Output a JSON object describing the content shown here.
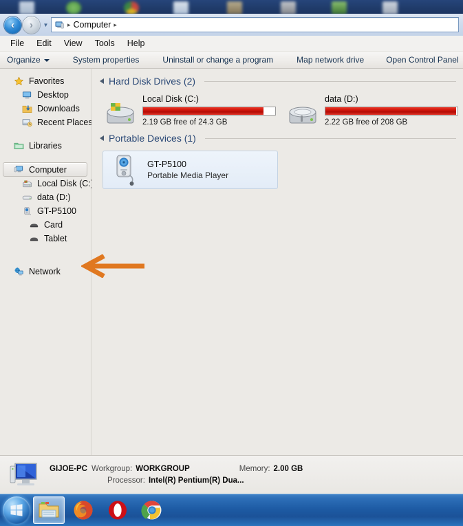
{
  "window": {
    "address": {
      "back_icon": "back-arrow-icon",
      "forward_icon": "forward-arrow-icon",
      "dropdown_icon": "chevron-down-icon",
      "computer_icon": "computer-icon",
      "breadcrumb": "Computer",
      "separator": "▸"
    },
    "menu": {
      "items": [
        {
          "label": "File"
        },
        {
          "label": "Edit"
        },
        {
          "label": "View"
        },
        {
          "label": "Tools"
        },
        {
          "label": "Help"
        }
      ]
    },
    "toolbar": {
      "organize_label": "Organize",
      "organize_caret_icon": "caret-down-icon",
      "items": [
        {
          "label": "System properties"
        },
        {
          "label": "Uninstall or change a program"
        },
        {
          "label": "Map network drive"
        },
        {
          "label": "Open Control Panel"
        }
      ]
    }
  },
  "sidebar": {
    "groups": [
      {
        "items": [
          {
            "label": "Favorites",
            "icon": "star-icon",
            "level": 0,
            "selected": false
          },
          {
            "label": "Desktop",
            "icon": "desktop-icon",
            "level": 1,
            "selected": false
          },
          {
            "label": "Downloads",
            "icon": "downloads-icon",
            "level": 1,
            "selected": false
          },
          {
            "label": "Recent Places",
            "icon": "recent-places-icon",
            "level": 1,
            "selected": false
          }
        ]
      },
      {
        "items": [
          {
            "label": "Libraries",
            "icon": "libraries-folder-icon",
            "level": 0,
            "selected": false
          }
        ]
      },
      {
        "items": [
          {
            "label": "Computer",
            "icon": "computer-icon",
            "level": 0,
            "selected": true
          },
          {
            "label": "Local Disk (C:)",
            "icon": "hard-disk-icon",
            "level": 1,
            "selected": false
          },
          {
            "label": "data (D:)",
            "icon": "drive-icon",
            "level": 1,
            "selected": false
          },
          {
            "label": "GT-P5100",
            "icon": "media-player-icon",
            "level": 1,
            "selected": false
          },
          {
            "label": "Card",
            "icon": "storage-card-icon",
            "level": 2,
            "selected": false
          },
          {
            "label": "Tablet",
            "icon": "storage-card-icon",
            "level": 2,
            "selected": false
          }
        ]
      },
      {
        "items": [
          {
            "label": "Network",
            "icon": "network-icon",
            "level": 0,
            "selected": false
          }
        ]
      }
    ]
  },
  "content": {
    "hard_disk_group": {
      "title": "Hard Disk Drives (2)",
      "collapse_icon": "collapse-triangle-icon",
      "drives": [
        {
          "name": "Local Disk (C:)",
          "free_text": "2.19 GB free of 24.3 GB",
          "used_percent": 91,
          "icon": "windows-hard-disk-icon"
        },
        {
          "name": "data (D:)",
          "free_text": "2.22 GB free of 208 GB",
          "used_percent": 99,
          "icon": "hard-disk-icon"
        }
      ]
    },
    "portable_group": {
      "title": "Portable Devices (1)",
      "collapse_icon": "collapse-triangle-icon",
      "devices": [
        {
          "name": "GT-P5100",
          "subtitle": "Portable Media Player",
          "icon": "media-player-icon"
        }
      ]
    },
    "annotation": {
      "icon": "left-arrow-annotation",
      "color": "#E07820"
    }
  },
  "status": {
    "icon": "computer-icon",
    "computer_name": "GIJOE-PC",
    "workgroup_label": "Workgroup:",
    "workgroup_value": "WORKGROUP",
    "memory_label": "Memory:",
    "memory_value": "2.00 GB",
    "processor_label": "Processor:",
    "processor_value": "Intel(R) Pentium(R) Dua..."
  },
  "taskbar": {
    "start_icon": "windows-start-orb-icon",
    "buttons": [
      {
        "icon": "file-explorer-icon",
        "active": true
      },
      {
        "icon": "firefox-icon",
        "active": false
      },
      {
        "icon": "opera-icon",
        "active": false
      },
      {
        "icon": "chrome-icon",
        "active": false
      }
    ]
  },
  "colors": {
    "accent_orange": "#E07820",
    "drive_red": "#D91B0F",
    "group_title": "#2C4A77",
    "taskbar_blue": "#1D5AA3"
  }
}
